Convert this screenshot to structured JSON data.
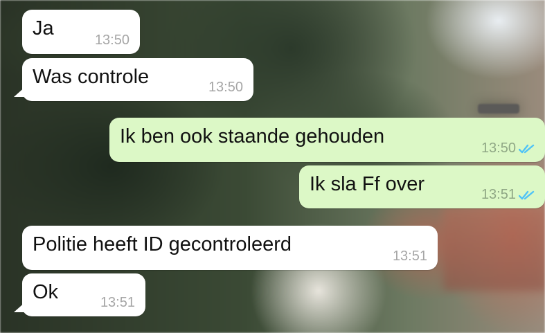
{
  "messages": [
    {
      "direction": "incoming",
      "text": "Ja",
      "time": "13:50"
    },
    {
      "direction": "incoming",
      "text": "Was controle",
      "time": "13:50"
    },
    {
      "direction": "outgoing",
      "text": "Ik ben ook staande gehouden",
      "time": "13:50",
      "status": "read"
    },
    {
      "direction": "outgoing",
      "text": "Ik sla Ff over",
      "time": "13:51",
      "status": "read"
    },
    {
      "direction": "incoming",
      "text": "Politie heeft ID gecontroleerd",
      "time": "13:51"
    },
    {
      "direction": "incoming",
      "text": "Ok",
      "time": "13:51"
    }
  ],
  "colors": {
    "incoming_bubble": "#ffffff",
    "outgoing_bubble": "#dcf8c6",
    "read_tick": "#4fc3f7"
  },
  "icons": {
    "read_receipt": "double-check-icon"
  }
}
